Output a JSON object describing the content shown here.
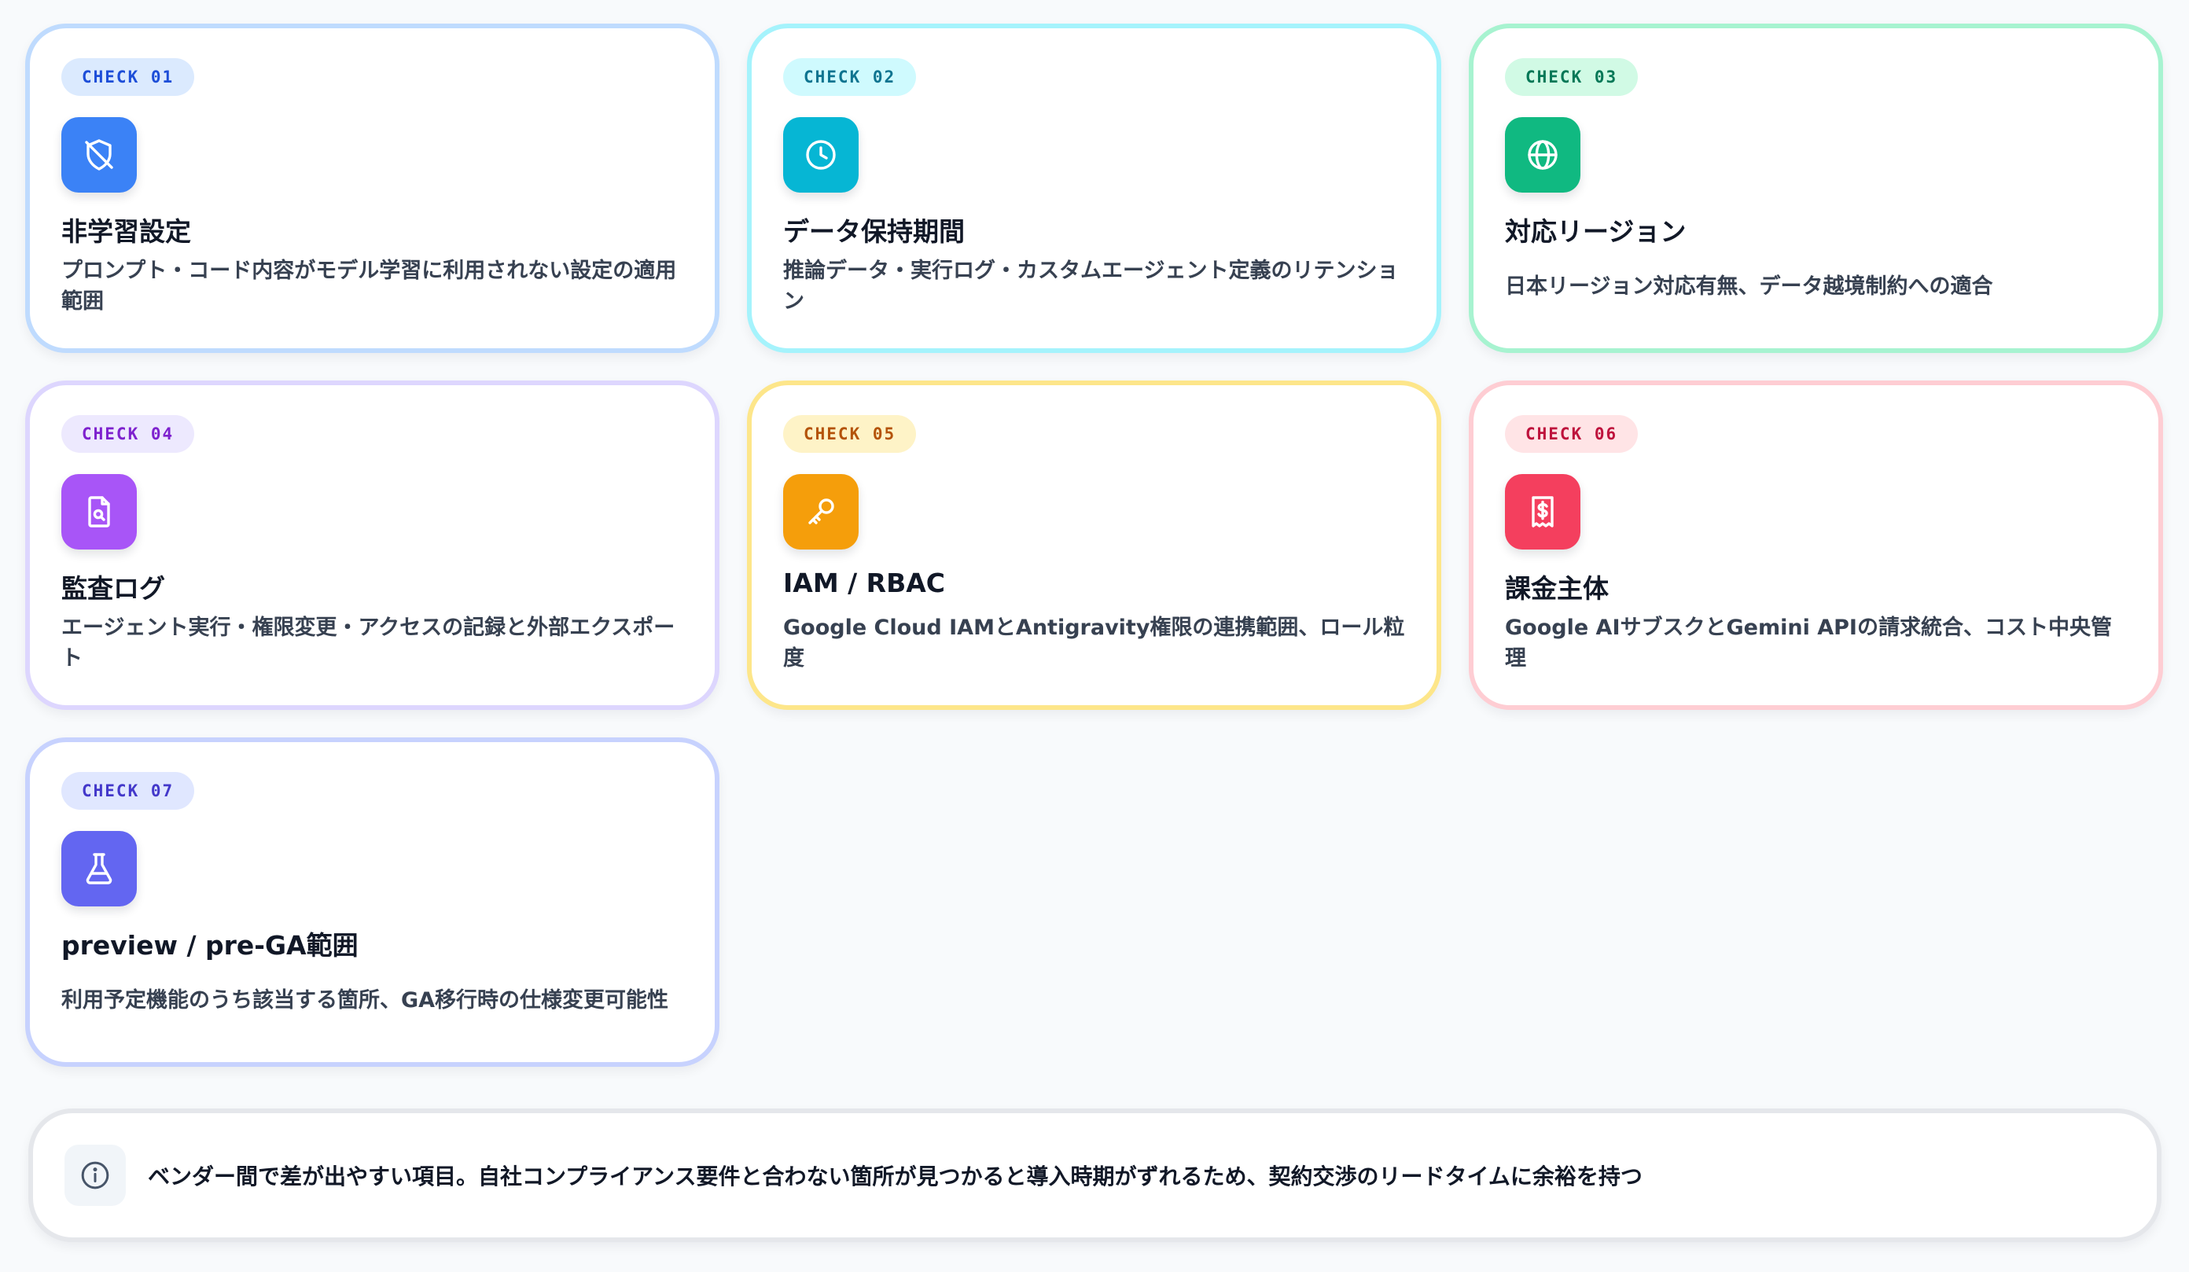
{
  "cards": [
    {
      "badge": "CHECK 01",
      "icon": "shield-off-icon",
      "title": "非学習設定",
      "description": "プロンプト・コード内容がモデル学習に利用されない設定の適用範囲",
      "colors": {
        "border": "#bfdbfe",
        "badge_bg": "#dbeafe",
        "badge_text": "#1d4ed8",
        "icon_bg": "#3b82f6"
      }
    },
    {
      "badge": "CHECK 02",
      "icon": "clock-icon",
      "title": "データ保持期間",
      "description": "推論データ・実行ログ・カスタムエージェント定義のリテンション",
      "colors": {
        "border": "#a5f3fc",
        "badge_bg": "#cffafe",
        "badge_text": "#0e7490",
        "icon_bg": "#06b6d4"
      }
    },
    {
      "badge": "CHECK 03",
      "icon": "globe-icon",
      "title": "対応リージョン",
      "description": "日本リージョン対応有無、データ越境制約への適合",
      "colors": {
        "border": "#a7f3d0",
        "badge_bg": "#d1fae5",
        "badge_text": "#047857",
        "icon_bg": "#10b981"
      }
    },
    {
      "badge": "CHECK 04",
      "icon": "file-search-icon",
      "title": "監査ログ",
      "description": "エージェント実行・権限変更・アクセスの記録と外部エクスポート",
      "colors": {
        "border": "#ddd6fe",
        "badge_bg": "#ede9fe",
        "badge_text": "#7e22ce",
        "icon_bg": "#a855f7"
      }
    },
    {
      "badge": "CHECK 05",
      "icon": "key-icon",
      "title": "IAM / RBAC",
      "description": "Google Cloud IAMとAntigravity権限の連携範囲、ロール粒度",
      "colors": {
        "border": "#fde68a",
        "badge_bg": "#fef3c7",
        "badge_text": "#b45309",
        "icon_bg": "#f59e0b"
      }
    },
    {
      "badge": "CHECK 06",
      "icon": "receipt-dollar-icon",
      "title": "課金主体",
      "description": "Google AIサブスクとGemini APIの請求統合、コスト中央管理",
      "colors": {
        "border": "#fecdd3",
        "badge_bg": "#ffe4e6",
        "badge_text": "#be123c",
        "icon_bg": "#f43f5e"
      }
    },
    {
      "badge": "CHECK 07",
      "icon": "flask-icon",
      "title": "preview / pre-GA範囲",
      "description": "利用予定機能のうち該当する箇所、GA移行時の仕様変更可能性",
      "colors": {
        "border": "#c7d2fe",
        "badge_bg": "#e0e7ff",
        "badge_text": "#4338ca",
        "icon_bg": "#6366f1"
      }
    }
  ],
  "note": {
    "icon": "info-icon",
    "text": "ベンダー間で差が出やすい項目。自社コンプライアンス要件と合わない箇所が見つかると導入時期がずれるため、契約交渉のリードタイムに余裕を持つ"
  }
}
